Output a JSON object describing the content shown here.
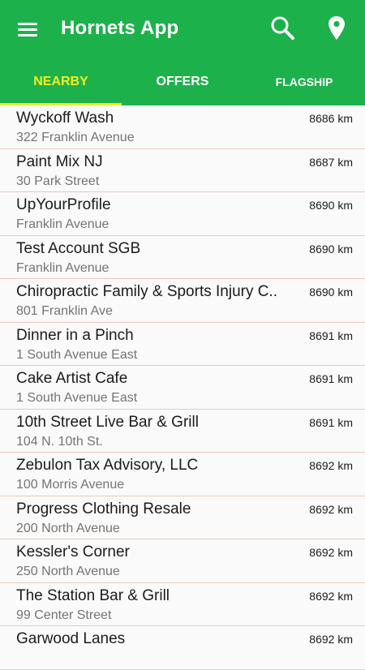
{
  "app": {
    "title": "Hornets App"
  },
  "toolbar": {
    "menu_icon": "hamburger-menu-icon",
    "search_icon": "search-icon",
    "location_icon": "map-pin-icon"
  },
  "colors": {
    "primary": "#1db14b",
    "accent": "#f2ee28",
    "divider": "#e9c9bd"
  },
  "tabs": [
    {
      "label": "NEARBY",
      "active": true
    },
    {
      "label": "OFFERS",
      "active": false
    },
    {
      "label": "FLAGSHIP",
      "active": false
    }
  ],
  "places": [
    {
      "name": "Wyckoff Wash",
      "address": "322 Franklin Avenue",
      "distance": "8686 km"
    },
    {
      "name": "Paint Mix NJ",
      "address": "30 Park Street",
      "distance": "8687 km"
    },
    {
      "name": "UpYourProfile",
      "address": "Franklin Avenue",
      "distance": "8690 km"
    },
    {
      "name": "Test Account SGB",
      "address": "Franklin Avenue",
      "distance": "8690 km"
    },
    {
      "name": "Chiropractic Family & Sports Injury C..",
      "address": "801 Franklin Ave",
      "distance": "8690 km"
    },
    {
      "name": "Dinner in a Pinch",
      "address": "1 South Avenue East",
      "distance": "8691 km"
    },
    {
      "name": "Cake Artist Cafe",
      "address": "1 South Avenue East",
      "distance": "8691 km"
    },
    {
      "name": "10th Street Live Bar & Grill",
      "address": "104 N. 10th St.",
      "distance": "8691 km"
    },
    {
      "name": "Zebulon Tax Advisory, LLC",
      "address": "100 Morris Avenue",
      "distance": "8692 km"
    },
    {
      "name": "Progress Clothing Resale",
      "address": "200 North Avenue",
      "distance": "8692 km"
    },
    {
      "name": "Kessler's Corner",
      "address": "250 North Avenue",
      "distance": "8692 km"
    },
    {
      "name": "The Station Bar & Grill",
      "address": "99 Center Street",
      "distance": "8692 km"
    },
    {
      "name": "Garwood Lanes",
      "address": "",
      "distance": "8692 km"
    }
  ]
}
